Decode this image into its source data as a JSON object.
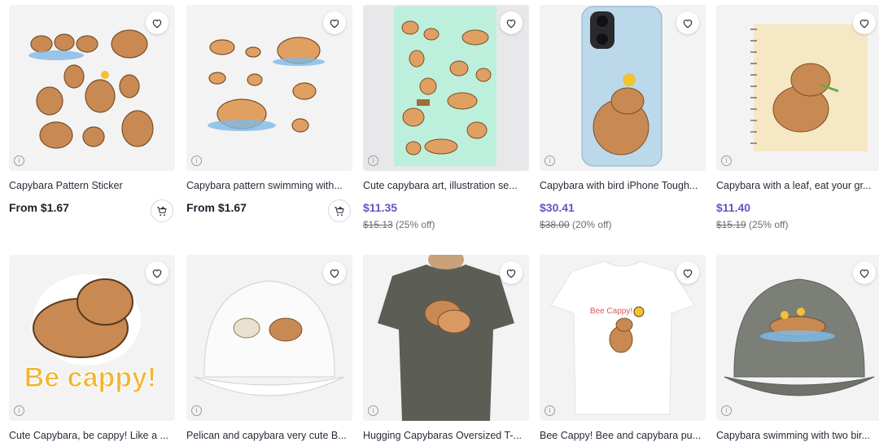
{
  "products": [
    {
      "title": "Capybara Pattern Sticker",
      "price": "From $1.67",
      "sale": false,
      "has_cart": true
    },
    {
      "title": "Capybara pattern swimming with...",
      "price": "From $1.67",
      "sale": false,
      "has_cart": true
    },
    {
      "title": "Cute capybara art, illustration se...",
      "price": "$11.35",
      "old_price": "$15.13",
      "discount": "(25% off)",
      "sale": true,
      "has_cart": false
    },
    {
      "title": "Capybara with bird iPhone Tough...",
      "price": "$30.41",
      "old_price": "$38.00",
      "discount": "(20% off)",
      "sale": true,
      "has_cart": false
    },
    {
      "title": "Capybara with a leaf, eat your gr...",
      "price": "$11.40",
      "old_price": "$15.19",
      "discount": "(25% off)",
      "sale": true,
      "has_cart": false
    },
    {
      "title": "Cute Capybara, be cappy! Like a ...",
      "sale": false,
      "has_cart": false,
      "art_text": "Be cappy!"
    },
    {
      "title": "Pelican and capybara very cute B...",
      "sale": false,
      "has_cart": false
    },
    {
      "title": "Hugging Capybaras Oversized T-...",
      "sale": false,
      "has_cart": false
    },
    {
      "title": "Bee Cappy! Bee and capybara pu...",
      "sale": false,
      "has_cart": false,
      "art_text": "Bee Cappy!"
    },
    {
      "title": "Capybara swimming with two bir...",
      "sale": false,
      "has_cart": false
    }
  ],
  "icons": {
    "favorite": "heart-icon",
    "info": "info-icon",
    "cart": "add-to-cart-icon"
  },
  "colors": {
    "sale_price": "#6a52c5",
    "capybara": "#c88a52"
  }
}
